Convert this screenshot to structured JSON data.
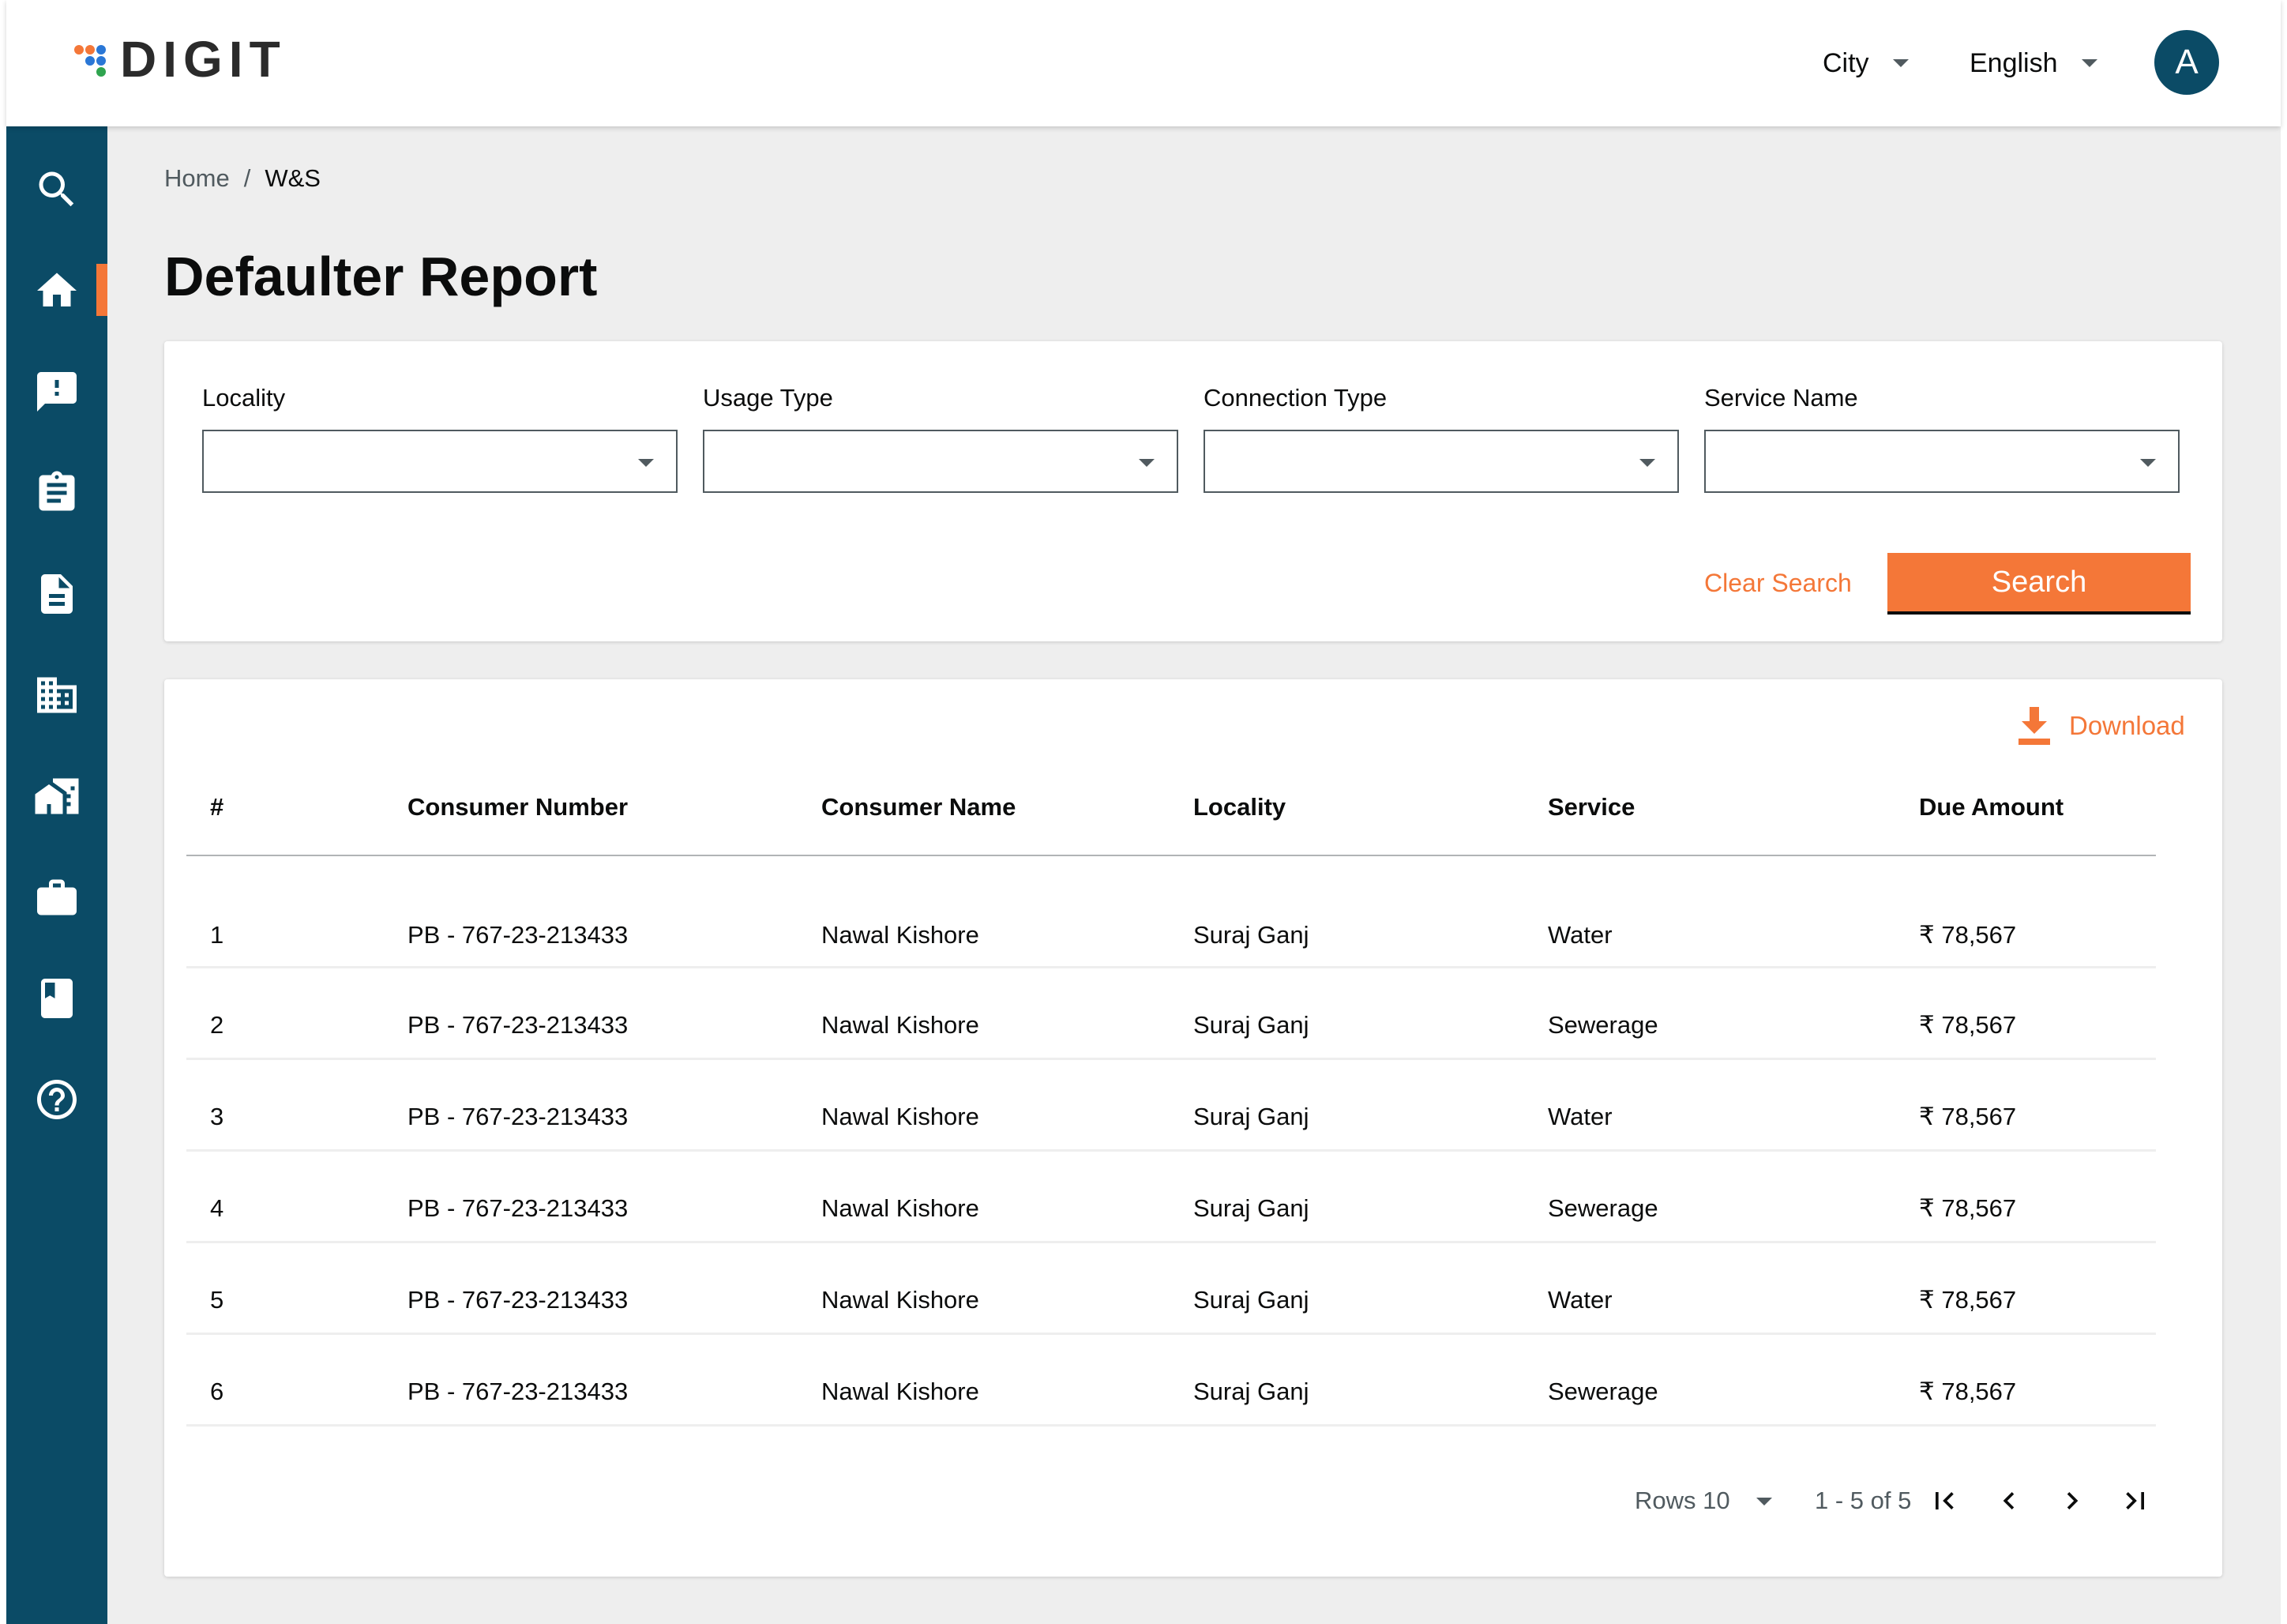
{
  "app": {
    "logo_text": "DIGIT"
  },
  "header": {
    "city_label": "City",
    "language_label": "English",
    "avatar_initial": "A"
  },
  "sidebar": {
    "items": [
      {
        "name": "search",
        "icon": "search-icon",
        "active": false
      },
      {
        "name": "home",
        "icon": "home-icon",
        "active": true
      },
      {
        "name": "complaints",
        "icon": "feedback-icon",
        "active": false
      },
      {
        "name": "assignments",
        "icon": "clipboard-icon",
        "active": false
      },
      {
        "name": "documents",
        "icon": "document-icon",
        "active": false
      },
      {
        "name": "property",
        "icon": "building-icon",
        "active": false
      },
      {
        "name": "city",
        "icon": "city-icon",
        "active": false
      },
      {
        "name": "business",
        "icon": "briefcase-icon",
        "active": false
      },
      {
        "name": "bookmark",
        "icon": "bookmark-icon",
        "active": false
      },
      {
        "name": "help",
        "icon": "help-icon",
        "active": false
      }
    ]
  },
  "breadcrumb": {
    "home": "Home",
    "separator": "/",
    "current": "W&S"
  },
  "page_title": "Defaulter Report",
  "filters": {
    "locality": {
      "label": "Locality",
      "value": ""
    },
    "usage_type": {
      "label": "Usage Type",
      "value": ""
    },
    "connection_type": {
      "label": "Connection Type",
      "value": ""
    },
    "service_name": {
      "label": "Service Name",
      "value": ""
    },
    "clear_label": "Clear Search",
    "search_label": "Search"
  },
  "results": {
    "download_label": "Download",
    "columns": [
      "#",
      "Consumer Number",
      "Consumer Name",
      "Locality",
      "Service",
      "Due Amount"
    ],
    "rows": [
      [
        "1",
        "PB - 767-23-213433",
        "Nawal Kishore",
        "Suraj Ganj",
        "Water",
        "₹ 78,567"
      ],
      [
        "2",
        "PB - 767-23-213433",
        "Nawal Kishore",
        "Suraj Ganj",
        "Sewerage",
        "₹ 78,567"
      ],
      [
        "3",
        "PB - 767-23-213433",
        "Nawal Kishore",
        "Suraj Ganj",
        "Water",
        "₹ 78,567"
      ],
      [
        "4",
        "PB - 767-23-213433",
        "Nawal Kishore",
        "Suraj Ganj",
        "Sewerage",
        "₹ 78,567"
      ],
      [
        "5",
        "PB - 767-23-213433",
        "Nawal Kishore",
        "Suraj Ganj",
        "Water",
        "₹ 78,567"
      ],
      [
        "6",
        "PB - 767-23-213433",
        "Nawal Kishore",
        "Suraj Ganj",
        "Sewerage",
        "₹ 78,567"
      ]
    ]
  },
  "pagination": {
    "rows_label": "Rows 10",
    "range_label": "1 - 5 of 5"
  },
  "colors": {
    "primary": "#0b4b66",
    "accent": "#f47738",
    "background": "#eeeeee",
    "text": "#0b0c0c"
  }
}
